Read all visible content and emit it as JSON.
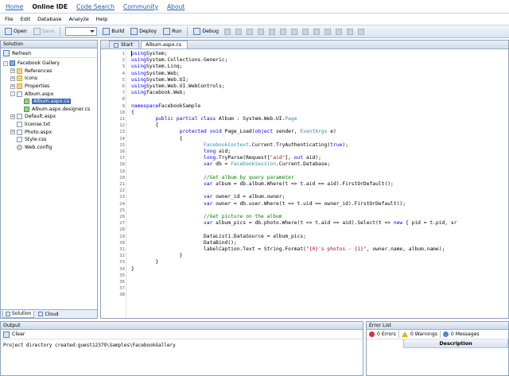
{
  "nav": {
    "links": [
      "Home",
      "Online IDE",
      "Code Search",
      "Community",
      "About"
    ],
    "active_index": 1
  },
  "menu": [
    "File",
    "Edit",
    "Database",
    "Analyze",
    "Help"
  ],
  "toolbar": {
    "open": "Open",
    "save": "Save",
    "build": "Build",
    "deploy": "Deploy",
    "run": "Run",
    "debug": "Debug"
  },
  "solution": {
    "title": "Solution",
    "refresh": "Refresh",
    "tree": [
      {
        "label": "Facebook Gallery",
        "level": 0,
        "expander": "-",
        "icon": "project-icon"
      },
      {
        "label": "References",
        "level": 1,
        "expander": "+",
        "icon": "folder-icon"
      },
      {
        "label": "Icons",
        "level": 1,
        "expander": "+",
        "icon": "folder-icon"
      },
      {
        "label": "Properties",
        "level": 1,
        "expander": "+",
        "icon": "folder-icon"
      },
      {
        "label": "Album.aspx",
        "level": 1,
        "expander": "-",
        "icon": "page-icon"
      },
      {
        "label": "Album.aspx.cs",
        "level": 2,
        "expander": "",
        "icon": "cs-file-icon",
        "selected": true
      },
      {
        "label": "Album.aspx.designer.cs",
        "level": 2,
        "expander": "",
        "icon": "cs-file-icon"
      },
      {
        "label": "Default.aspx",
        "level": 1,
        "expander": "+",
        "icon": "page-icon"
      },
      {
        "label": "license.txt",
        "level": 1,
        "expander": "",
        "icon": "text-file-icon"
      },
      {
        "label": "Photo.aspx",
        "level": 1,
        "expander": "+",
        "icon": "page-icon"
      },
      {
        "label": "Style.css",
        "level": 1,
        "expander": "",
        "icon": "css-file-icon"
      },
      {
        "label": "Web.config",
        "level": 1,
        "expander": "",
        "icon": "config-icon"
      }
    ],
    "tabs": [
      "Solution",
      "Cloud"
    ]
  },
  "editor": {
    "tabs": [
      "Start",
      "Album.aspx.cs"
    ],
    "active_tab": 1,
    "line_count": 38,
    "lines": [
      [
        [
          "kw",
          "using"
        ],
        [
          "",
          "System;"
        ]
      ],
      [
        [
          "kw",
          "using"
        ],
        [
          "",
          "System.Collections.Generic;"
        ]
      ],
      [
        [
          "kw",
          "using"
        ],
        [
          "",
          "System.Linq;"
        ]
      ],
      [
        [
          "kw",
          "using"
        ],
        [
          "",
          "System.Web;"
        ]
      ],
      [
        [
          "kw",
          "using"
        ],
        [
          "",
          "System.Web.UI;"
        ]
      ],
      [
        [
          "kw",
          "using"
        ],
        [
          "",
          "System.Web.UI.WebControls;"
        ]
      ],
      [
        [
          "kw",
          "using"
        ],
        [
          "",
          "facebook.Web;"
        ]
      ],
      [],
      [
        [
          "kw",
          "namespace"
        ],
        [
          "",
          "FacebookSample"
        ]
      ],
      [
        [
          "",
          "{"
        ]
      ],
      [
        [
          "",
          "        "
        ],
        [
          "kw",
          "public partial class"
        ],
        [
          "",
          " Album : System.Web.UI."
        ],
        [
          "ty",
          "Page"
        ]
      ],
      [
        [
          "",
          "        {"
        ]
      ],
      [
        [
          "",
          "                "
        ],
        [
          "kw",
          "protected void"
        ],
        [
          "",
          " Page_Load("
        ],
        [
          "kw",
          "object"
        ],
        [
          "",
          " sender, "
        ],
        [
          "ty",
          "EventArgs"
        ],
        [
          "",
          " e)"
        ]
      ],
      [
        [
          "",
          "                {"
        ]
      ],
      [
        [
          "",
          "                        "
        ],
        [
          "ty",
          "FacebookContext"
        ],
        [
          "",
          ".Current.TryAuthenticating("
        ],
        [
          "kw",
          "true"
        ],
        [
          "",
          ");"
        ]
      ],
      [
        [
          "",
          "                        "
        ],
        [
          "kw",
          "long"
        ],
        [
          "",
          " aid;"
        ]
      ],
      [
        [
          "",
          "                        "
        ],
        [
          "kw",
          "long"
        ],
        [
          "",
          ".TryParse(Request["
        ],
        [
          "st",
          "\"aid\""
        ],
        [
          "",
          "], "
        ],
        [
          "kw",
          "out"
        ],
        [
          "",
          " aid);"
        ]
      ],
      [
        [
          "",
          "                        "
        ],
        [
          "kw",
          "var"
        ],
        [
          "",
          " db = "
        ],
        [
          "ty",
          "FacebookSession"
        ],
        [
          "",
          ".Current.Database;"
        ]
      ],
      [],
      [
        [
          "",
          "                        "
        ],
        [
          "cm",
          "//Get album by query parameter"
        ]
      ],
      [
        [
          "",
          "                        "
        ],
        [
          "kw",
          "var"
        ],
        [
          "",
          " album = db.album.Where(t => t.aid == aid).FirstOrDefault();"
        ]
      ],
      [],
      [
        [
          "",
          "                        "
        ],
        [
          "kw",
          "var"
        ],
        [
          "",
          " owner_id = album.owner;"
        ]
      ],
      [
        [
          "",
          "                        "
        ],
        [
          "kw",
          "var"
        ],
        [
          "",
          " owner = db.user.Where(t => t.uid == owner_id).FirstOrDefault();"
        ]
      ],
      [],
      [
        [
          "",
          "                        "
        ],
        [
          "cm",
          "//Get picture on the album"
        ]
      ],
      [
        [
          "",
          "                        "
        ],
        [
          "kw",
          "var"
        ],
        [
          "",
          " album_pics = db.photo.Where(t => t.aid == aid).Select(t => "
        ],
        [
          "kw",
          "new"
        ],
        [
          "",
          " { pid = t.pid, sr"
        ]
      ],
      [],
      [
        [
          "",
          "                        "
        ],
        [
          "",
          "DataList1.DataSource = album_pics;"
        ]
      ],
      [
        [
          "",
          "                        "
        ],
        [
          "",
          "DataBind();"
        ]
      ],
      [
        [
          "",
          "                        "
        ],
        [
          "",
          "labelCaption.Text = String.Format("
        ],
        [
          "st",
          "\"{0}'s photos - {1}\""
        ],
        [
          "",
          ", owner.name, album.name);"
        ]
      ],
      [
        [
          "",
          "                }"
        ]
      ],
      [
        [
          "",
          "        }"
        ]
      ],
      [
        [
          "",
          "}"
        ]
      ]
    ]
  },
  "output": {
    "title": "Output",
    "clear": "Clear",
    "text": "Project directory created:guest12379\\Samples\\FacebookGallery"
  },
  "errors": {
    "title": "Error List",
    "errors": "0 Errors",
    "warnings": "0 Warnings",
    "messages": "0 Messages",
    "column": "Description"
  }
}
